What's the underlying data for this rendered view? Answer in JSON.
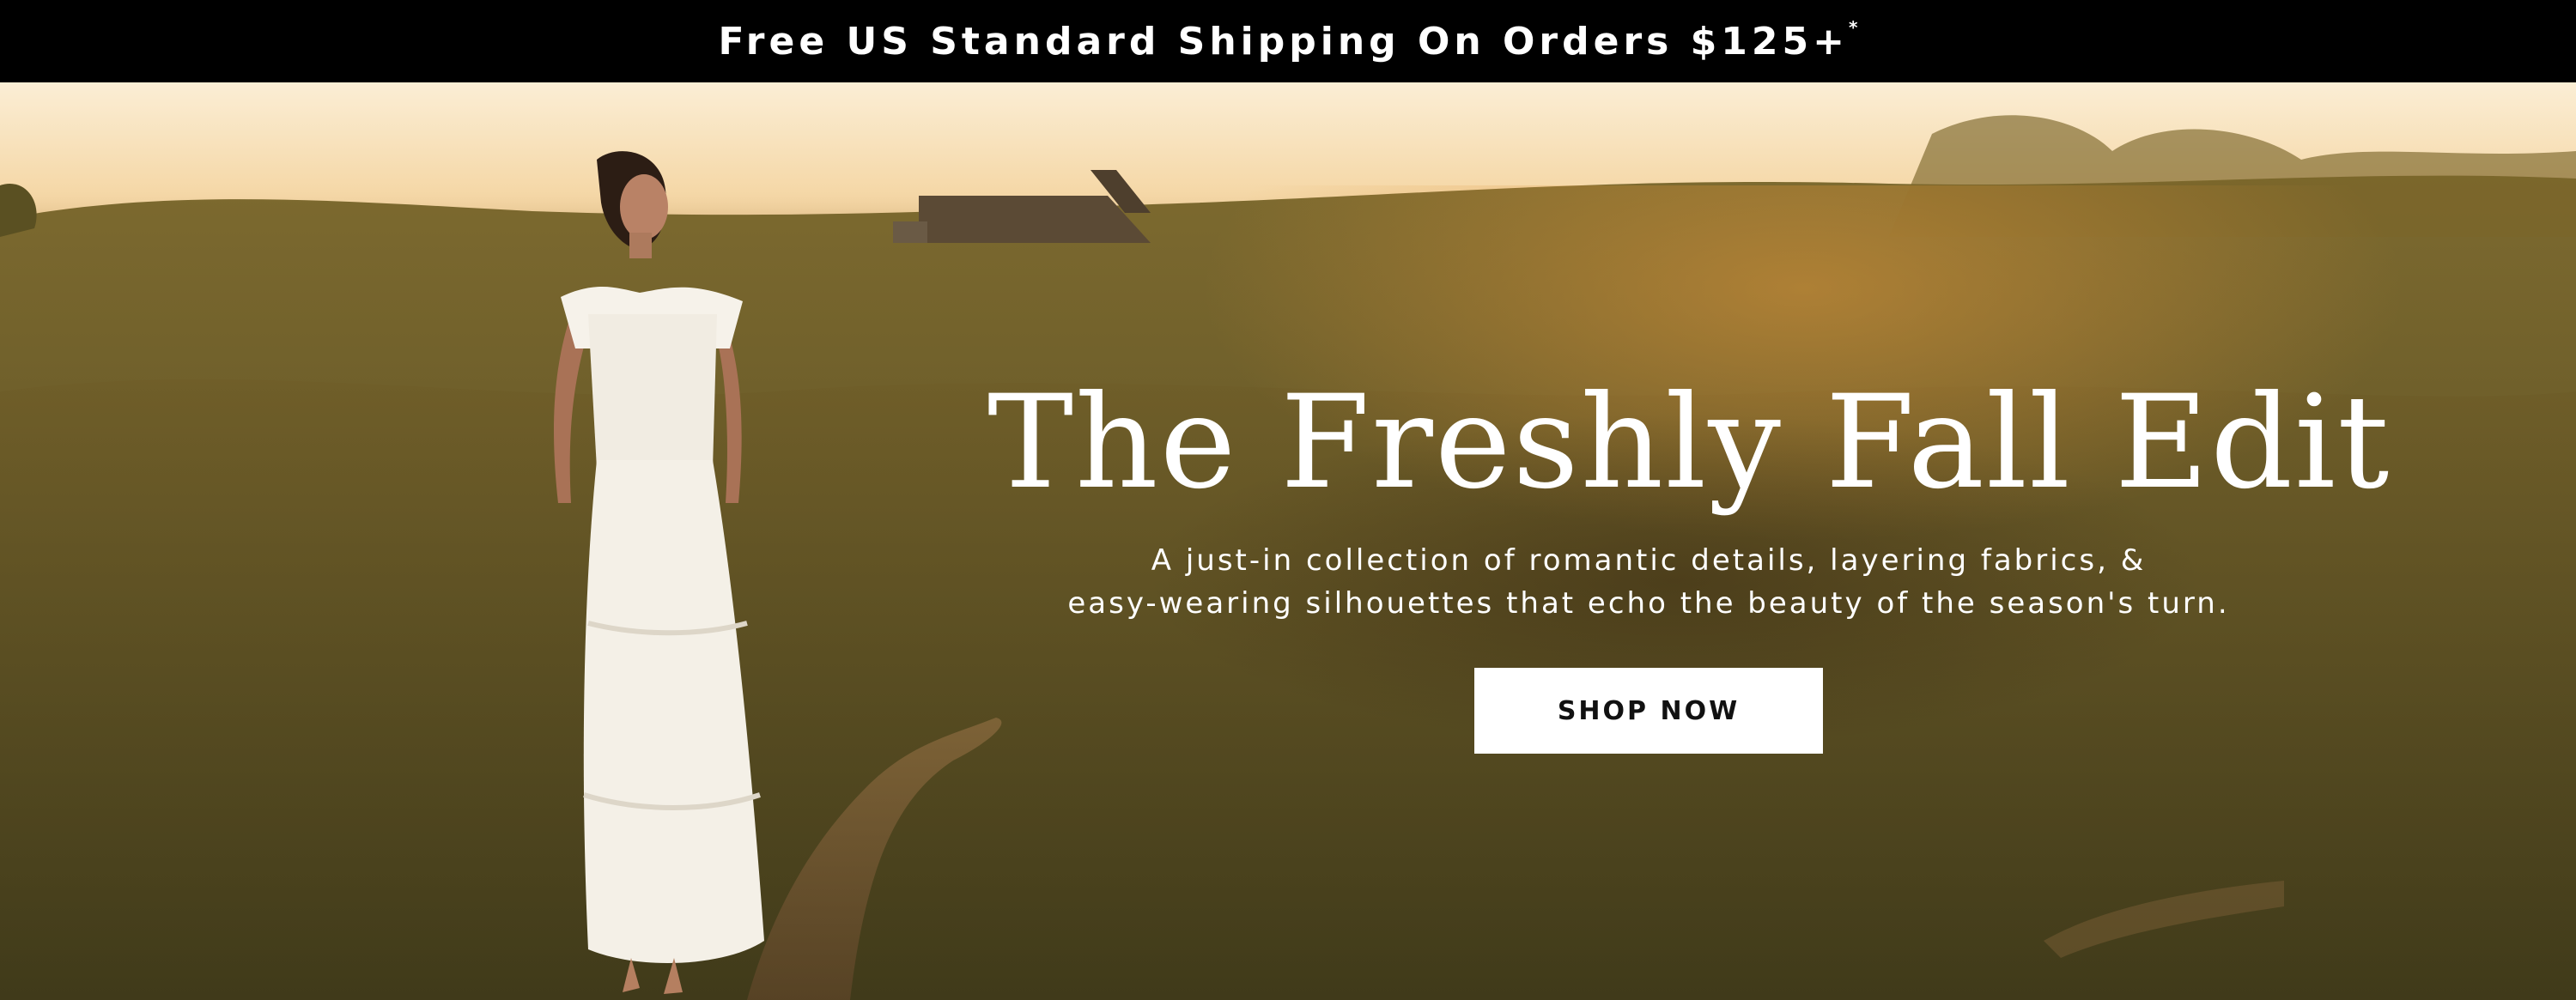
{
  "announcement": {
    "text": "Free US Standard Shipping On Orders $125+",
    "superscript": "*"
  },
  "hero": {
    "title": "The Freshly Fall Edit",
    "subtitle_line1": "A just-in collection of romantic details, layering fabrics, &",
    "subtitle_line2": "easy-wearing silhouettes that echo the beauty of the season's turn.",
    "cta_label": "SHOP NOW"
  },
  "colors": {
    "announcement_bg": "#000000",
    "announcement_text": "#ffffff",
    "hero_text": "#ffffff",
    "button_bg": "#ffffff",
    "button_text": "#111111"
  }
}
